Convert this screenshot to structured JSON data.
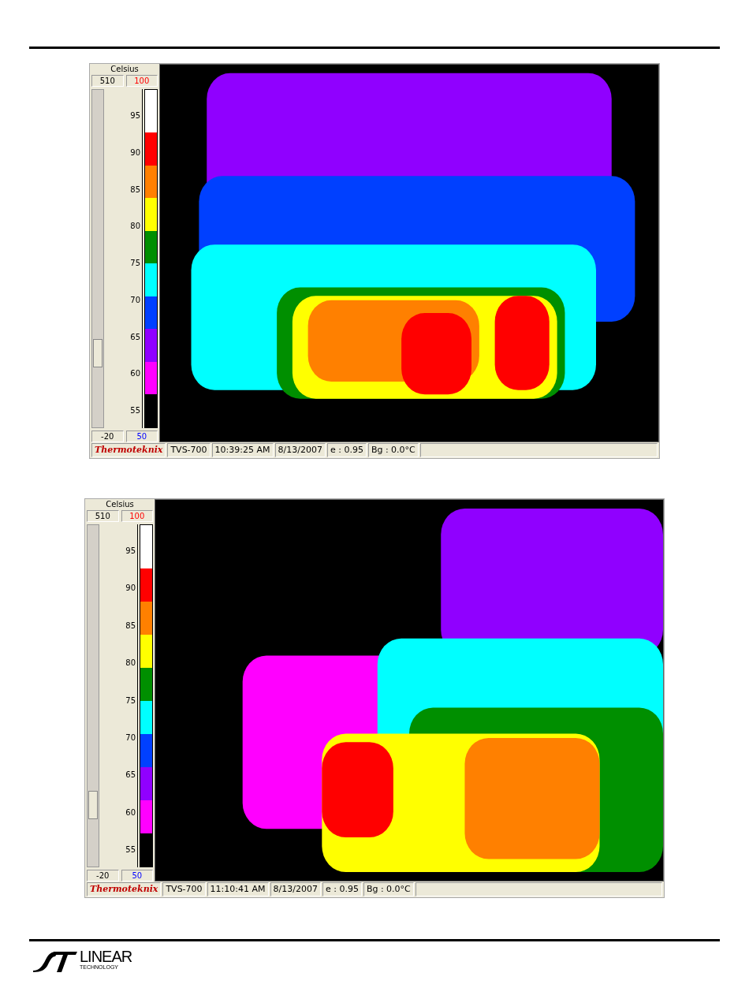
{
  "panels": [
    {
      "unit": "Celsius",
      "top_values": [
        "510",
        "100"
      ],
      "bottom_values": [
        "-20",
        "50"
      ],
      "slider": {
        "level": 0.22
      },
      "ticks": [
        "95",
        "90",
        "85",
        "80",
        "75",
        "70",
        "65",
        "60",
        "55"
      ],
      "bands": [
        {
          "color": "#ffffff"
        },
        {
          "color": "#ff0000"
        },
        {
          "color": "#ff8000"
        },
        {
          "color": "#ffff00"
        },
        {
          "color": "#008f00"
        },
        {
          "color": "#00ffff"
        },
        {
          "color": "#0040ff"
        },
        {
          "color": "#9000ff"
        },
        {
          "color": "#ff00ff"
        },
        {
          "color": "#000000"
        }
      ],
      "status_bar": {
        "brand": "Thermoteknix",
        "fields": [
          "TVS-700",
          "10:39:25 AM",
          "8/13/2007",
          "e : 0.95",
          "Bg : 0.0°C"
        ]
      }
    },
    {
      "unit": "Celsius",
      "top_values": [
        "510",
        "100"
      ],
      "bottom_values": [
        "-20",
        "50"
      ],
      "slider": {
        "level": 0.18
      },
      "ticks": [
        "95",
        "90",
        "85",
        "80",
        "75",
        "70",
        "65",
        "60",
        "55"
      ],
      "bands": [
        {
          "color": "#ffffff"
        },
        {
          "color": "#ff0000"
        },
        {
          "color": "#ff8000"
        },
        {
          "color": "#ffff00"
        },
        {
          "color": "#008f00"
        },
        {
          "color": "#00ffff"
        },
        {
          "color": "#0040ff"
        },
        {
          "color": "#9000ff"
        },
        {
          "color": "#ff00ff"
        },
        {
          "color": "#000000"
        }
      ],
      "status_bar": {
        "brand": "Thermoteknix",
        "fields": [
          "TVS-700",
          "11:10:41 AM",
          "8/13/2007",
          "e : 0.95",
          "Bg : 0.0°C"
        ]
      }
    }
  ],
  "footer": {
    "logo_word": "LINEAR",
    "logo_sub": "TECHNOLOGY"
  }
}
